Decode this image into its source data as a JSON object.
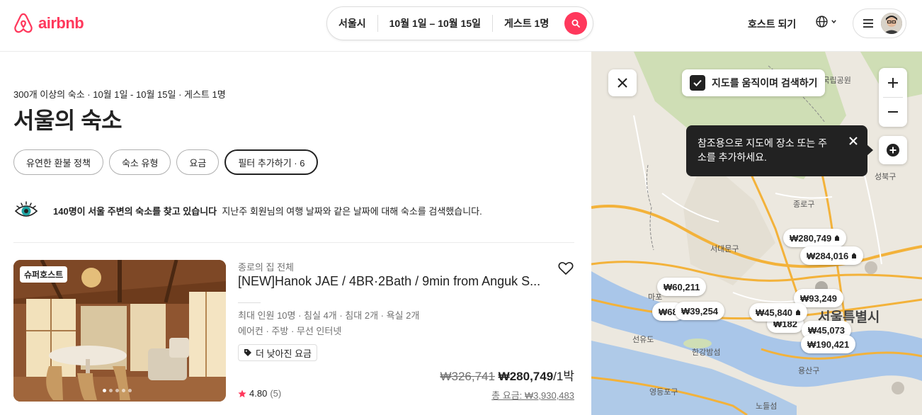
{
  "header": {
    "logo_text": "airbnb",
    "search": {
      "location": "서울시",
      "dates": "10월 1일 – 10월 15일",
      "guests": "게스트 1명"
    },
    "host_link": "호스트 되기",
    "icons": {
      "logo": "airbnb-logo-icon",
      "search": "search-icon",
      "globe": "globe-icon",
      "menu": "menu-icon"
    }
  },
  "results": {
    "summary": "300개 이상의 숙소 · 10월 1일 - 10월 15일 · 게스트 1명",
    "title": "서울의 숙소",
    "filters": [
      "유연한 환불 정책",
      "숙소 유형",
      "요금",
      "필터 추가하기 · 6"
    ],
    "banner": {
      "bold": "140명이 서울 주변의 숙소를 찾고 있습니다",
      "text": "지난주 회원님의 여행 날짜와 같은 날짜에 대해 숙소를 검색했습니다."
    }
  },
  "listing": {
    "badge": "슈퍼호스트",
    "type": "종로의 집 전체",
    "name": "[NEW]Hanok JAE / 4BR·2Bath / 9min from Anguk S...",
    "details": "최대 인원 10명 · 침실 4개 · 침대 2개 · 욕실 2개",
    "amenities": "에어컨 · 주방 · 무선 인터넷",
    "tag": "더 낮아진 요금",
    "rating": "4.80",
    "reviews": "(5)",
    "old_price": "₩326,741",
    "price": "₩280,749",
    "per_night": "/1박",
    "total": "총 요금: ₩3,930,483",
    "photo_count": 5,
    "photo_index": 1
  },
  "map": {
    "move_search_label": "지도를 움직이며 검색하기",
    "tooltip": "참조용으로 지도에 장소 또는 주소를 추가하세요.",
    "pins": [
      "₩280,749",
      "₩284,016",
      "₩60,211",
      "₩68",
      "₩39,254",
      "₩93,249",
      "₩45,840",
      "₩182",
      "₩45,073",
      "₩190,421"
    ],
    "labels": [
      "종로구",
      "서대문구",
      "서울특별시",
      "선유도",
      "한강밤섬",
      "용산구",
      "영등포구",
      "노들섬",
      "성북구",
      "마포",
      "북한산국립공원"
    ]
  },
  "colors": {
    "brand": "#FF385C",
    "text": "#222222",
    "muted": "#717171"
  }
}
